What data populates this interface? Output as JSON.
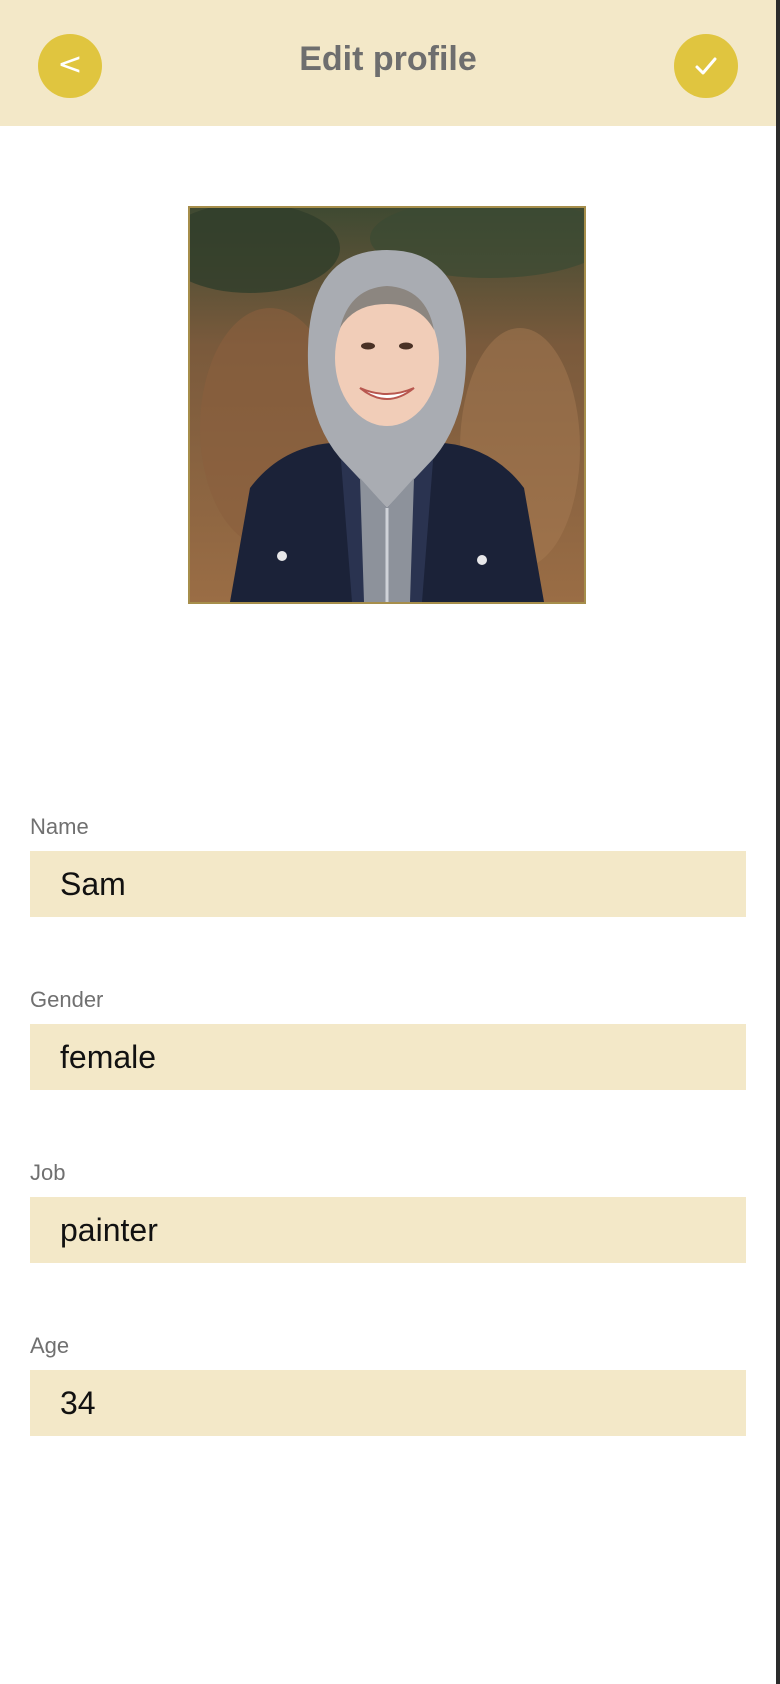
{
  "header": {
    "title": "Edit profile",
    "back_label": "<",
    "back_icon": "back-chevron-icon",
    "confirm_icon": "checkmark-icon",
    "accent_color": "#e0c53f",
    "background_color": "#f3e8c8"
  },
  "profile_photo": {
    "icon": "profile-photo"
  },
  "form": {
    "fields": [
      {
        "label": "Name",
        "value": "Sam"
      },
      {
        "label": "Gender",
        "value": "female"
      },
      {
        "label": "Job",
        "value": "painter"
      },
      {
        "label": "Age",
        "value": "34"
      }
    ]
  }
}
